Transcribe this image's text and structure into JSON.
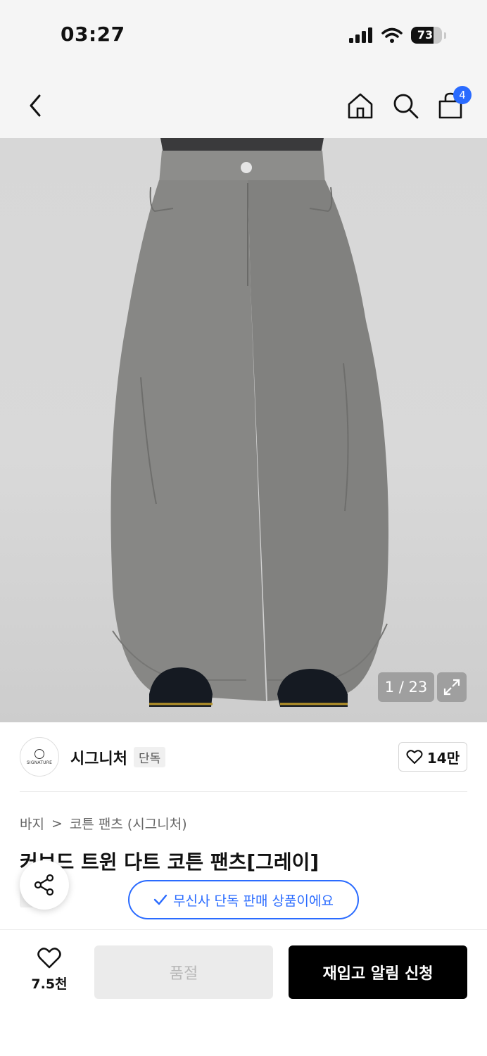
{
  "status_bar": {
    "time": "03:27",
    "battery": "73",
    "battery_level": 0.73
  },
  "header": {
    "cart_badge": "4"
  },
  "product_image": {
    "counter": "1 / 23"
  },
  "brand": {
    "name": "시그니처",
    "tag": "단독",
    "logo_text": "SIGNATURE",
    "likes": "14만"
  },
  "breadcrumb": {
    "category": "바지",
    "separator": ">",
    "subcategory": "코튼 팬츠 (시그니처)"
  },
  "product": {
    "title": "커브드 트윈 다트 코튼 팬츠[그레이]",
    "exclusive_tag": "단독"
  },
  "toast": {
    "text": "무신사 단독 판매 상품이에요"
  },
  "bottom_bar": {
    "wish_count": "7.5천",
    "soldout_label": "품절",
    "restock_label": "재입고 알림 신청"
  },
  "colors": {
    "accent": "#2a6bff",
    "primary_button": "#000000",
    "disabled_button": "#ebebeb"
  }
}
